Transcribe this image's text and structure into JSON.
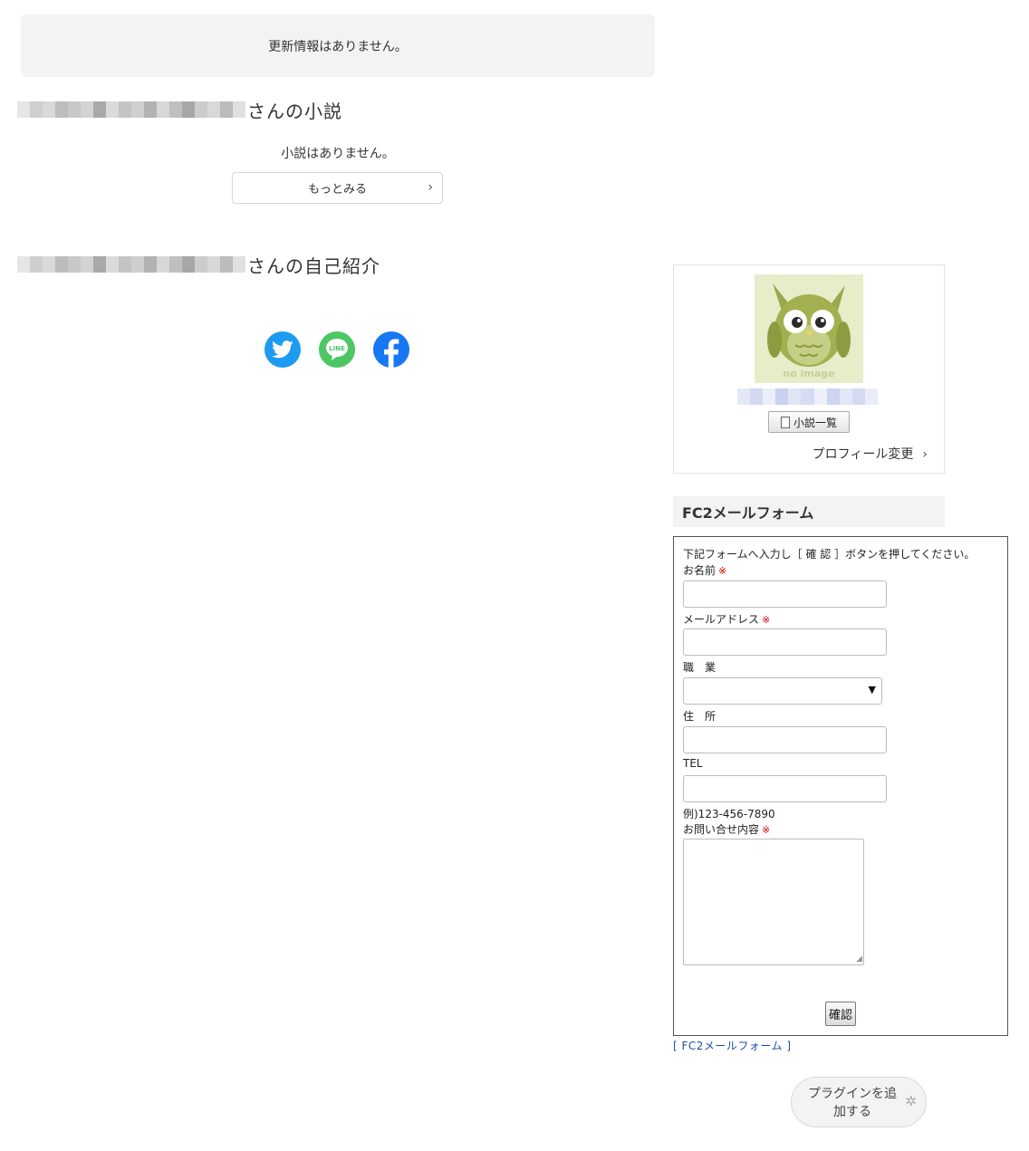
{
  "updates": {
    "message": "更新情報はありません。"
  },
  "novels": {
    "title_suffix": "さんの小説",
    "empty_message": "小説はありません。",
    "more_label": "もっとみる",
    "more_chevron": "›"
  },
  "intro": {
    "title_suffix": "さんの自己紹介"
  },
  "share": {
    "icons": [
      "twitter-icon",
      "line-icon",
      "facebook-icon"
    ],
    "colors": {
      "twitter": "#1d9bf0",
      "line": "#4cc764",
      "facebook": "#1877f2"
    }
  },
  "profile": {
    "avatar_text": "no image",
    "novel_list_label": "小説一覧",
    "change_label": "プロフィール変更",
    "change_chevron": "›"
  },
  "fc2": {
    "header": "FC2メールフォーム",
    "instruction": "下記フォームへ入力し［ 確 認 ］ボタンを押してください。",
    "required_mark": "※",
    "name_label": "お名前",
    "email_label": "メールアドレス",
    "job_label": "職　業",
    "job_selected": "",
    "address_label": "住　所",
    "tel_label": "TEL",
    "tel_example": "例)123-456-7890",
    "inquiry_label": "お問い合せ内容",
    "confirm_label": "確認",
    "footer_link": "[ FC2メールフォーム ]"
  },
  "plugin": {
    "label": "プラグインを追加する"
  }
}
